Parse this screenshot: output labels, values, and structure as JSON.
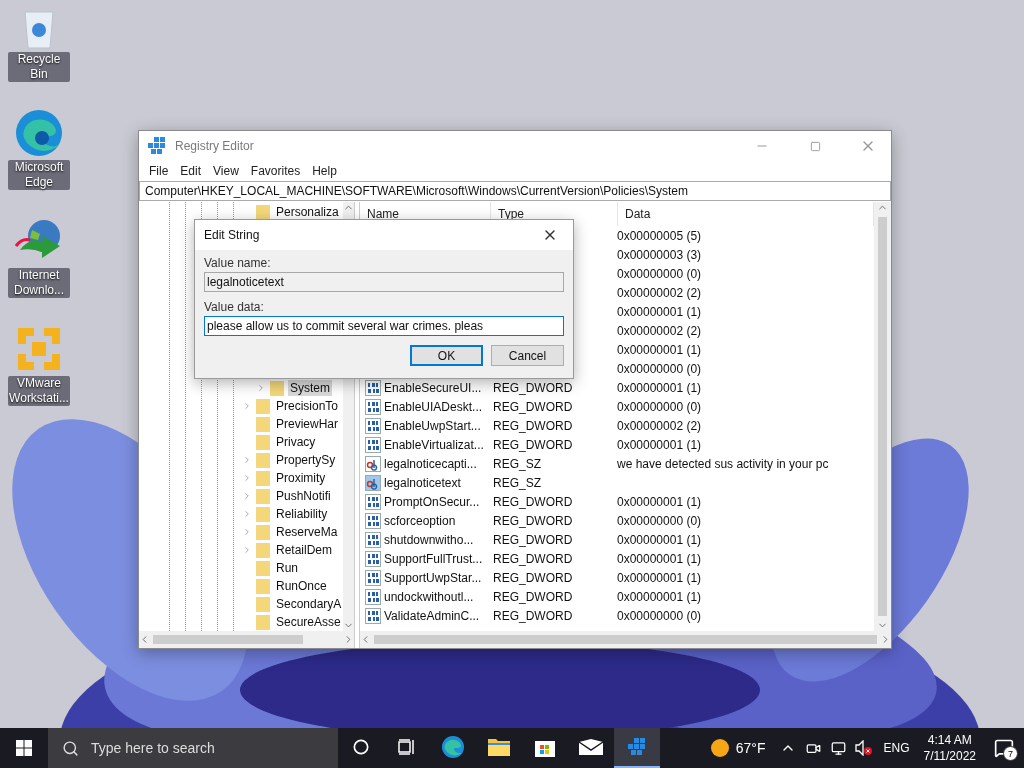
{
  "desktop_icons": [
    {
      "kind": "recycle",
      "label": "Recycle Bin"
    },
    {
      "kind": "edge",
      "label": "Microsoft Edge"
    },
    {
      "kind": "downloader",
      "label": "Internet Downlo..."
    },
    {
      "kind": "vmware",
      "label": "VMware Workstati..."
    }
  ],
  "window": {
    "title": "Registry Editor",
    "menu": [
      "File",
      "Edit",
      "View",
      "Favorites",
      "Help"
    ],
    "address": "Computer\\HKEY_LOCAL_MACHINE\\SOFTWARE\\Microsoft\\Windows\\CurrentVersion\\Policies\\System",
    "tree_top": [
      {
        "label": "Personaliza",
        "expandable": false,
        "selected": false
      }
    ],
    "tree": [
      {
        "label": "System",
        "expandable": true,
        "selected": true
      },
      {
        "label": "PrecisionTo",
        "expandable": true,
        "selected": false
      },
      {
        "label": "PreviewHar",
        "expandable": false,
        "selected": false
      },
      {
        "label": "Privacy",
        "expandable": false,
        "selected": false
      },
      {
        "label": "PropertySy",
        "expandable": true,
        "selected": false
      },
      {
        "label": "Proximity",
        "expandable": true,
        "selected": false
      },
      {
        "label": "PushNotifi",
        "expandable": true,
        "selected": false
      },
      {
        "label": "Reliability",
        "expandable": true,
        "selected": false
      },
      {
        "label": "ReserveMa",
        "expandable": true,
        "selected": false
      },
      {
        "label": "RetailDem",
        "expandable": true,
        "selected": false
      },
      {
        "label": "Run",
        "expandable": false,
        "selected": false
      },
      {
        "label": "RunOnce",
        "expandable": false,
        "selected": false
      },
      {
        "label": "SecondaryA",
        "expandable": false,
        "selected": false
      },
      {
        "label": "SecureAsse",
        "expandable": false,
        "selected": false
      }
    ],
    "columns": [
      "Name",
      "Type",
      "Data"
    ],
    "rows": [
      {
        "data": "0x00000005 (5)"
      },
      {
        "data": "0x00000003 (3)"
      },
      {
        "data": "0x00000000 (0)"
      },
      {
        "data": "0x00000002 (2)"
      },
      {
        "data": "0x00000001 (1)"
      },
      {
        "data": "0x00000002 (2)"
      },
      {
        "data": "0x00000001 (1)"
      },
      {
        "data": "0x00000000 (0)"
      },
      {
        "kind": "dword",
        "name": "EnableSecureUI...",
        "type": "REG_DWORD",
        "data": "0x00000001 (1)",
        "selected": false
      },
      {
        "kind": "dword",
        "name": "EnableUIADeskt...",
        "type": "REG_DWORD",
        "data": "0x00000000 (0)",
        "selected": false
      },
      {
        "kind": "dword",
        "name": "EnableUwpStart...",
        "type": "REG_DWORD",
        "data": "0x00000002 (2)",
        "selected": false
      },
      {
        "kind": "dword",
        "name": "EnableVirtualizat...",
        "type": "REG_DWORD",
        "data": "0x00000001 (1)",
        "selected": false
      },
      {
        "kind": "string",
        "name": "legalnoticecapti...",
        "type": "REG_SZ",
        "data": "we have detected sus activity in your pc",
        "selected": false
      },
      {
        "kind": "string",
        "name": "legalnoticetext",
        "type": "REG_SZ",
        "selected": true
      },
      {
        "kind": "dword",
        "name": "PromptOnSecur...",
        "type": "REG_DWORD",
        "data": "0x00000001 (1)",
        "selected": false
      },
      {
        "kind": "dword",
        "name": "scforceoption",
        "type": "REG_DWORD",
        "data": "0x00000000 (0)",
        "selected": false
      },
      {
        "kind": "dword",
        "name": "shutdownwitho...",
        "type": "REG_DWORD",
        "data": "0x00000001 (1)",
        "selected": false
      },
      {
        "kind": "dword",
        "name": "SupportFullTrust...",
        "type": "REG_DWORD",
        "data": "0x00000001 (1)",
        "selected": false
      },
      {
        "kind": "dword",
        "name": "SupportUwpStar...",
        "type": "REG_DWORD",
        "data": "0x00000001 (1)",
        "selected": false
      },
      {
        "kind": "dword",
        "name": "undockwithoutl...",
        "type": "REG_DWORD",
        "data": "0x00000001 (1)",
        "selected": false
      },
      {
        "kind": "dword",
        "name": "ValidateAdminC...",
        "type": "REG_DWORD",
        "data": "0x00000000 (0)",
        "selected": false
      }
    ]
  },
  "dialog": {
    "title": "Edit String",
    "name_label": "Value name:",
    "name_value": "legalnoticetext",
    "data_label": "Value data:",
    "data_value": "please allow us to commit several war crimes. pleas",
    "buttons": [
      {
        "label": "OK",
        "default": true
      },
      {
        "label": "Cancel",
        "default": false
      }
    ]
  },
  "taskbar": {
    "search_placeholder": "Type here to search",
    "apps": [
      {
        "kind": "edge",
        "active": false
      },
      {
        "kind": "folder",
        "active": false
      },
      {
        "kind": "store",
        "active": false
      },
      {
        "kind": "mail",
        "active": false
      },
      {
        "kind": "regedit",
        "active": true
      }
    ],
    "weather": "67°F",
    "language": "ENG",
    "time": "4:14 AM",
    "date": "7/11/2022",
    "notifications": "7"
  }
}
